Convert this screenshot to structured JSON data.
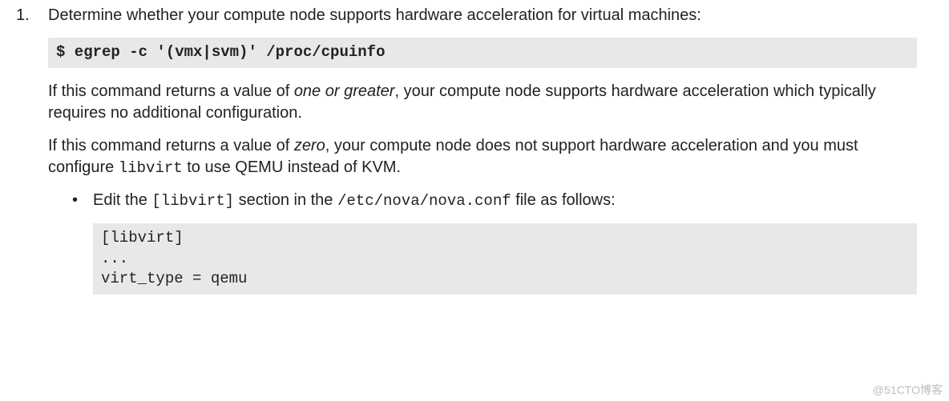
{
  "step": {
    "number": "1.",
    "intro": "Determine whether your compute node supports hardware acceleration for virtual machines:",
    "command1": "$ egrep -c '(vmx|svm)' /proc/cpuinfo",
    "para2_pre": "If this command returns a value of ",
    "para2_em": "one or greater",
    "para2_post": ", your compute node supports hardware acceleration which typically requires no additional configuration.",
    "para3_pre": "If this command returns a value of ",
    "para3_em": "zero",
    "para3_mid": ", your compute node does not support hardware acceleration and you must configure ",
    "para3_code": "libvirt",
    "para3_post": " to use QEMU instead of KVM.",
    "sub": {
      "bullet": "•",
      "line_pre": "Edit the ",
      "line_code1": "[libvirt]",
      "line_mid": " section in the ",
      "line_code2": "/etc/nova/nova.conf",
      "line_post": " file as follows:",
      "codeblock": "[libvirt]\n...\nvirt_type = qemu"
    }
  },
  "watermark": "@51CTO博客"
}
